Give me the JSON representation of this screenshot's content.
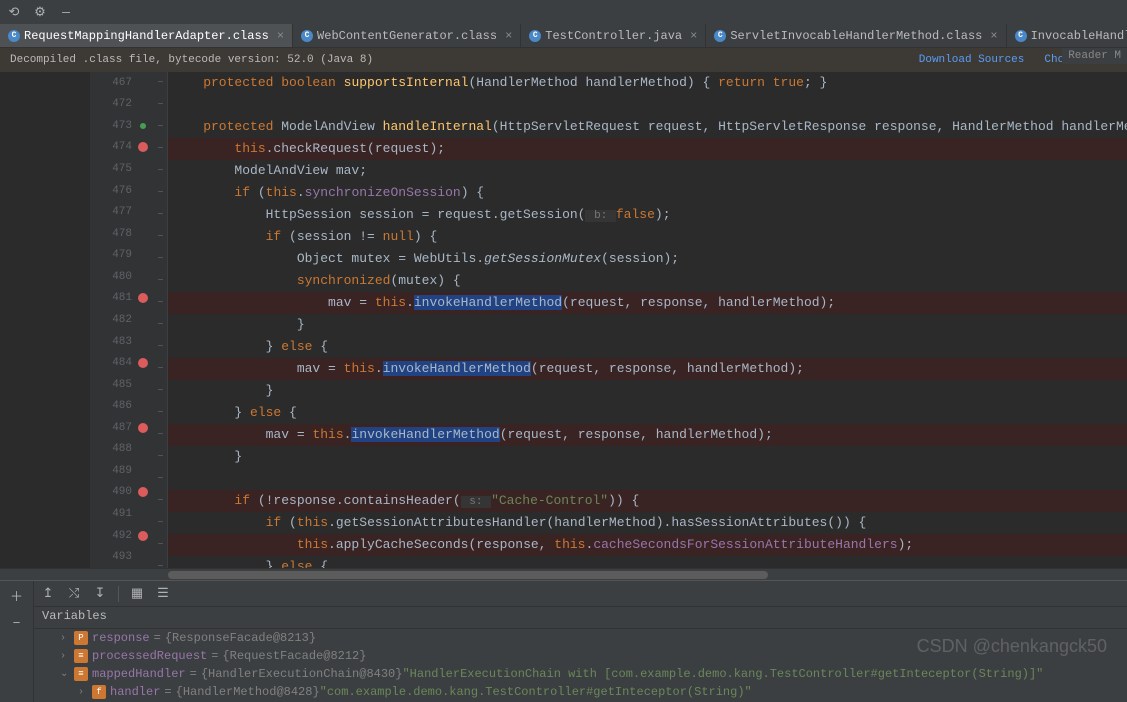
{
  "toolbar_collapse": "—",
  "tabs": [
    {
      "icon": "C",
      "label": "RequestMappingHandlerAdapter.class",
      "active": true
    },
    {
      "icon": "C",
      "label": "WebContentGenerator.class",
      "active": false
    },
    {
      "icon": "C",
      "label": "TestController.java",
      "active": false
    },
    {
      "icon": "C",
      "label": "ServletInvocableHandlerMethod.class",
      "active": false
    },
    {
      "icon": "C",
      "label": "InvocableHandle",
      "active": false
    }
  ],
  "banner": {
    "text": "Decompiled .class file, bytecode version: 52.0 (Java 8)",
    "link1": "Download Sources",
    "link2": "Choose Sour"
  },
  "reader_badge": "Reader M",
  "gutter": [
    {
      "n": "467",
      "bp": false,
      "green": false
    },
    {
      "n": "472",
      "bp": false,
      "green": false
    },
    {
      "n": "473",
      "bp": false,
      "green": true
    },
    {
      "n": "474",
      "bp": true,
      "green": false
    },
    {
      "n": "475",
      "bp": false,
      "green": false
    },
    {
      "n": "476",
      "bp": false,
      "green": false
    },
    {
      "n": "477",
      "bp": false,
      "green": false
    },
    {
      "n": "478",
      "bp": false,
      "green": false
    },
    {
      "n": "479",
      "bp": false,
      "green": false
    },
    {
      "n": "480",
      "bp": false,
      "green": false
    },
    {
      "n": "481",
      "bp": true,
      "green": false
    },
    {
      "n": "482",
      "bp": false,
      "green": false
    },
    {
      "n": "483",
      "bp": false,
      "green": false
    },
    {
      "n": "484",
      "bp": true,
      "green": false
    },
    {
      "n": "485",
      "bp": false,
      "green": false
    },
    {
      "n": "486",
      "bp": false,
      "green": false
    },
    {
      "n": "487",
      "bp": true,
      "bulb": true
    },
    {
      "n": "488",
      "bp": false,
      "green": false
    },
    {
      "n": "489",
      "bp": false,
      "green": false
    },
    {
      "n": "490",
      "bp": true,
      "green": false
    },
    {
      "n": "491",
      "bp": false,
      "green": false
    },
    {
      "n": "492",
      "bp": true,
      "green": false
    },
    {
      "n": "493",
      "bp": false,
      "green": false
    }
  ],
  "code": {
    "l0_a": "    protected boolean ",
    "l0_b": "supportsInternal",
    "l0_c": "(HandlerMethod handlerMethod) { ",
    "l0_d": "return true",
    "l0_e": "; }",
    "l1": "",
    "l2_a": "    protected ",
    "l2_b": "ModelAndView ",
    "l2_c": "handleInternal",
    "l2_d": "(HttpServletRequest request, HttpServletResponse response, HandlerMethod handlerMethod)",
    "l3_a": "        this",
    "l3_b": ".checkRequest(request);",
    "l4_a": "        ModelAndView mav;",
    "l5_a": "        if ",
    "l5_b": "(",
    "l5_c": "this",
    "l5_d": ".",
    "l5_e": "synchronizeOnSession",
    "l5_f": ") {",
    "l6_a": "            HttpSession session = request.getSession(",
    "l6_hint": " b: ",
    "l6_b": "false",
    "l6_c": ");",
    "l7_a": "            if ",
    "l7_b": "(session != ",
    "l7_c": "null",
    "l7_d": ") {",
    "l8_a": "                Object mutex = WebUtils.",
    "l8_b": "getSessionMutex",
    "l8_c": "(session);",
    "l9_a": "                synchronized",
    "l9_b": "(mutex) {",
    "l10_a": "                    mav = ",
    "l10_b": "this",
    "l10_c": ".",
    "l10_d": "invokeHandlerMethod",
    "l10_e": "(request, response, handlerMethod);",
    "l11_a": "                }",
    "l12_a": "            } ",
    "l12_b": "else ",
    "l12_c": "{",
    "l13_a": "                mav = ",
    "l13_b": "this",
    "l13_c": ".",
    "l13_d": "invokeHandlerMethod",
    "l13_e": "(request, response, handlerMethod);",
    "l14_a": "            }",
    "l15_a": "        } ",
    "l15_b": "else ",
    "l15_c": "{",
    "l16_a": "            mav = ",
    "l16_b": "this",
    "l16_c": ".",
    "l16_d": "invokeHandlerMethod",
    "l16_e": "(request, response, handlerMethod);",
    "l17_a": "        }",
    "l18": "",
    "l19_a": "        if ",
    "l19_b": "(!response.containsHeader(",
    "l19_hint": " s: ",
    "l19_c": "\"Cache-Control\"",
    "l19_d": ")) {",
    "l20_a": "            if ",
    "l20_b": "(",
    "l20_c": "this",
    "l20_d": ".getSessionAttributesHandler(handlerMethod).hasSessionAttributes()) {",
    "l21_a": "                this",
    "l21_b": ".applyCacheSeconds(response, ",
    "l21_c": "this",
    "l21_d": ".",
    "l21_e": "cacheSecondsForSessionAttributeHandlers",
    "l21_f": ");",
    "l22_a": "            } ",
    "l22_b": "else ",
    "l22_c": "{"
  },
  "vars_header": "Variables",
  "vars": [
    {
      "indent": 1,
      "arrow": "›",
      "icon": "P",
      "name": "response",
      "eq": " = ",
      "val": "{ResponseFacade@8213}"
    },
    {
      "indent": 1,
      "arrow": "›",
      "icon": "≡",
      "name": "processedRequest",
      "eq": " = ",
      "val": "{RequestFacade@8212}"
    },
    {
      "indent": 1,
      "arrow": "⌄",
      "icon": "≡",
      "name": "mappedHandler",
      "eq": " = ",
      "val": "{HandlerExecutionChain@8430}",
      "str": " \"HandlerExecutionChain with [com.example.demo.kang.TestController#getInteceptor(String)]\""
    },
    {
      "indent": 2,
      "arrow": "›",
      "icon": "f",
      "name": "handler",
      "eq": " = ",
      "val": "{HandlerMethod@8428}",
      "str": " \"com.example.demo.kang.TestController#getInteceptor(String)\""
    }
  ],
  "watermark": "CSDN @chenkangck50"
}
